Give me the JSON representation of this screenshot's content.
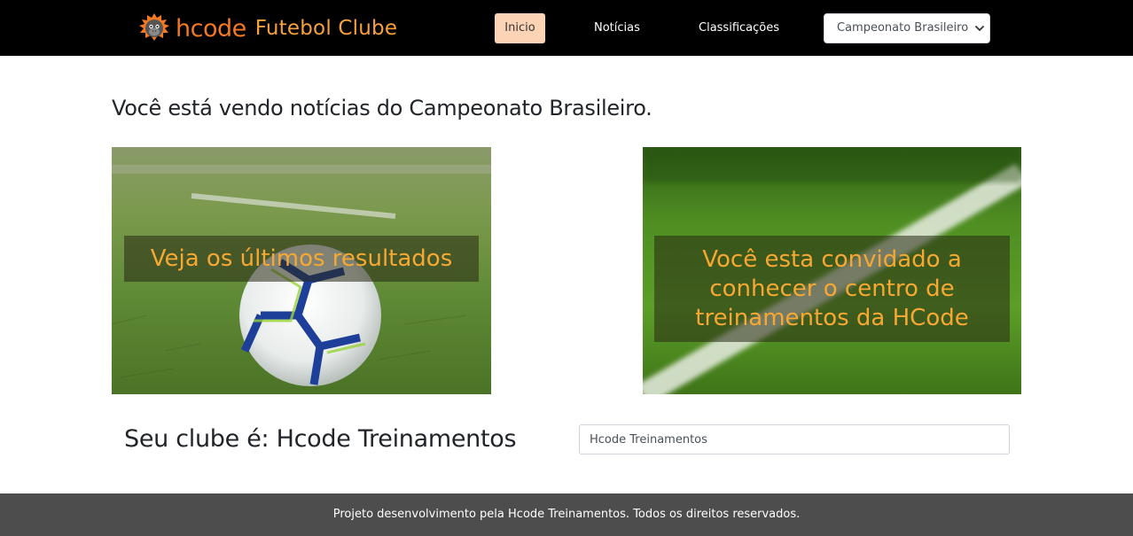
{
  "navbar": {
    "brand_logo_icon": "monkey-face-icon",
    "brand_name": "hcode",
    "brand_subtitle": "Futebol Clube",
    "links": {
      "inicio": "Inicio",
      "noticias": "Notícias",
      "classificacoes": "Classificações"
    },
    "championship_select": {
      "selected": "Campeonato Brasileiro",
      "chevron_icon": "chevron-down-icon"
    }
  },
  "main": {
    "heading": "Você está vendo notícias do Campeonato Brasileiro.",
    "cards": [
      {
        "caption": "Veja os últimos resultados",
        "image": "soccer-ball-on-grass"
      },
      {
        "caption": "Você esta convidado a conhecer o centro de treinamentos da HCode",
        "image": "grass-field-with-line"
      }
    ],
    "club_title": "Seu clube é: Hcode Treinamentos",
    "club_input_value": "Hcode Treinamentos"
  },
  "footer": {
    "text": "Projeto desenvolvimento pela Hcode Treinamentos. Todos os direitos reservados."
  },
  "colors": {
    "navbar_bg": "#000000",
    "brand_orange": "#f47920",
    "caption_text": "#f6a832",
    "active_nav_bg": "#fcd3b5",
    "footer_bg": "#4d4d4d"
  }
}
